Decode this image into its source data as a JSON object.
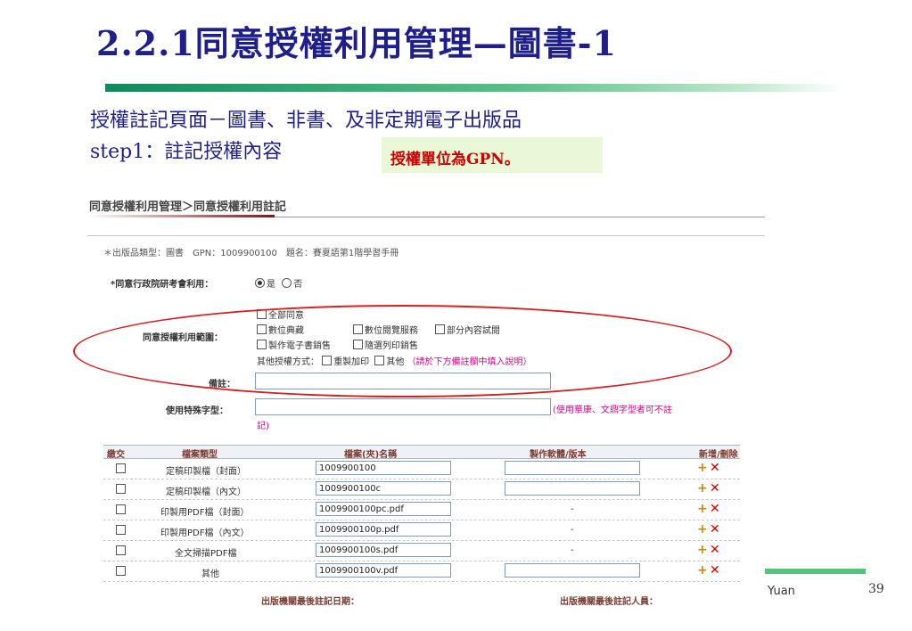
{
  "slide": {
    "title": "2.2.1同意授權利用管理—圖書-1",
    "subtitle_line1": "授權註記頁面－圖書、非書、及非定期電子出版品",
    "subtitle_line2": "step1：註記授權內容",
    "note": "授權單位為GPN。",
    "author": "Yuan",
    "page_number": "39"
  },
  "screen": {
    "breadcrumb": "同意授權利用管理＞同意授權利用註記",
    "info": "＊出版品類型：圖書　GPN：1009900100　題名：賽夏語第1階學習手冊",
    "consent": {
      "label": "*同意行政院研考會利用：",
      "yes": "是",
      "no": "否"
    },
    "scope": {
      "label": "同意授權利用範圍：",
      "all": "全部同意",
      "digital_archive": "數位典藏",
      "digital_browse": "數位閱覽服務",
      "partial_trial": "部分內容試閱",
      "ebook_sales": "製作電子書銷售",
      "pod_sales": "隨選列印銷售",
      "other_methods": "其他授權方式：",
      "reprint": "重製加印",
      "other": "其他",
      "other_note": "（請於下方備註欄中填入說明）"
    },
    "remarks_label": "備註：",
    "special_font": {
      "label": "使用特殊字型：",
      "note": "(使用華康、文鼎字型者可不註",
      "note_cont": "記)"
    },
    "table": {
      "headers": [
        "繳交",
        "檔案類型",
        "檔案(夾)名稱",
        "製作軟體/版本",
        "新增/刪除"
      ],
      "rows": [
        {
          "type": "定稿印製檔（封面）",
          "name": "1009900100",
          "software": ""
        },
        {
          "type": "定稿印製檔（內文）",
          "name": "1009900100c",
          "software": ""
        },
        {
          "type": "印製用PDF檔（封面）",
          "name": "1009900100pc.pdf",
          "software": "-"
        },
        {
          "type": "印製用PDF檔（內文）",
          "name": "1009900100p.pdf",
          "software": "-"
        },
        {
          "type": "全文掃描PDF檔",
          "name": "1009900100s.pdf",
          "software": "-"
        },
        {
          "type": "其他",
          "name": "1009900100v.pdf",
          "software": ""
        }
      ]
    },
    "footer": {
      "date_label": "出版機關最後註記日期：",
      "person_label": "出版機關最後註記人員："
    }
  },
  "colors": {
    "title": "#1f1f8c",
    "note_text": "#cc0000",
    "note_bg": "#e9f8d6",
    "highlight_ellipse": "#d42020",
    "accent_green": "#57c27d"
  }
}
